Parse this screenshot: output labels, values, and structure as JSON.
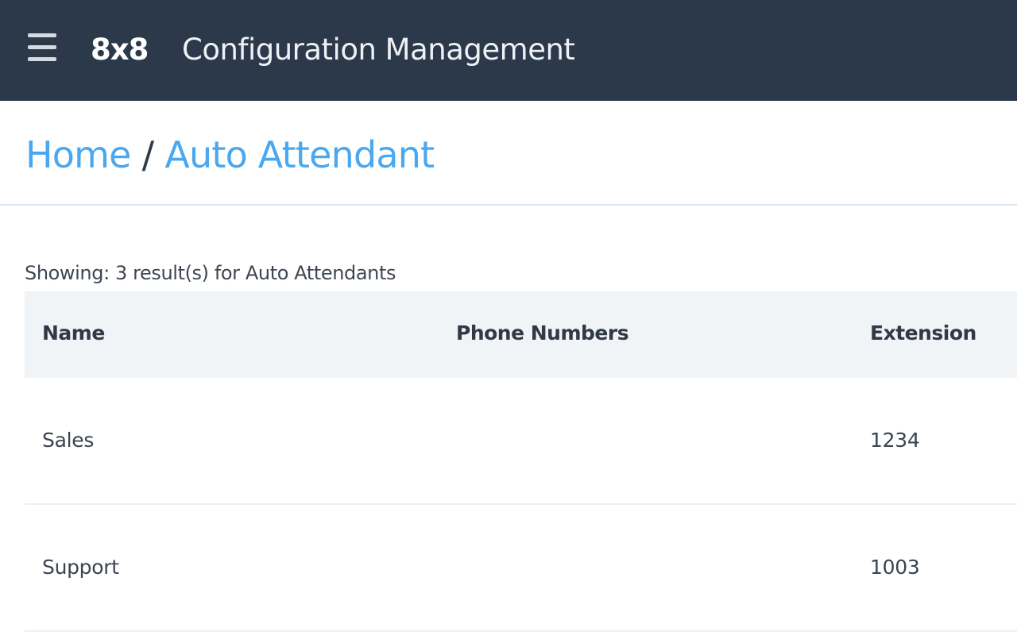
{
  "header": {
    "menu_icon": "hamburger-menu-icon",
    "logo_text": "8x8",
    "title": "Configuration Management",
    "background_color": "#2b394b"
  },
  "breadcrumb": {
    "items": [
      {
        "label": "Home"
      },
      {
        "label": "Auto Attendant"
      }
    ],
    "separator": "/",
    "link_color": "#4aa8f0"
  },
  "results": {
    "summary": "Showing: 3 result(s) for Auto Attendants"
  },
  "table": {
    "columns": [
      "Name",
      "Phone Numbers",
      "Extension"
    ],
    "rows": [
      {
        "name": "Sales",
        "phone_numbers": "",
        "extension": "1234"
      },
      {
        "name": "Support",
        "phone_numbers": "",
        "extension": "1003"
      }
    ]
  }
}
